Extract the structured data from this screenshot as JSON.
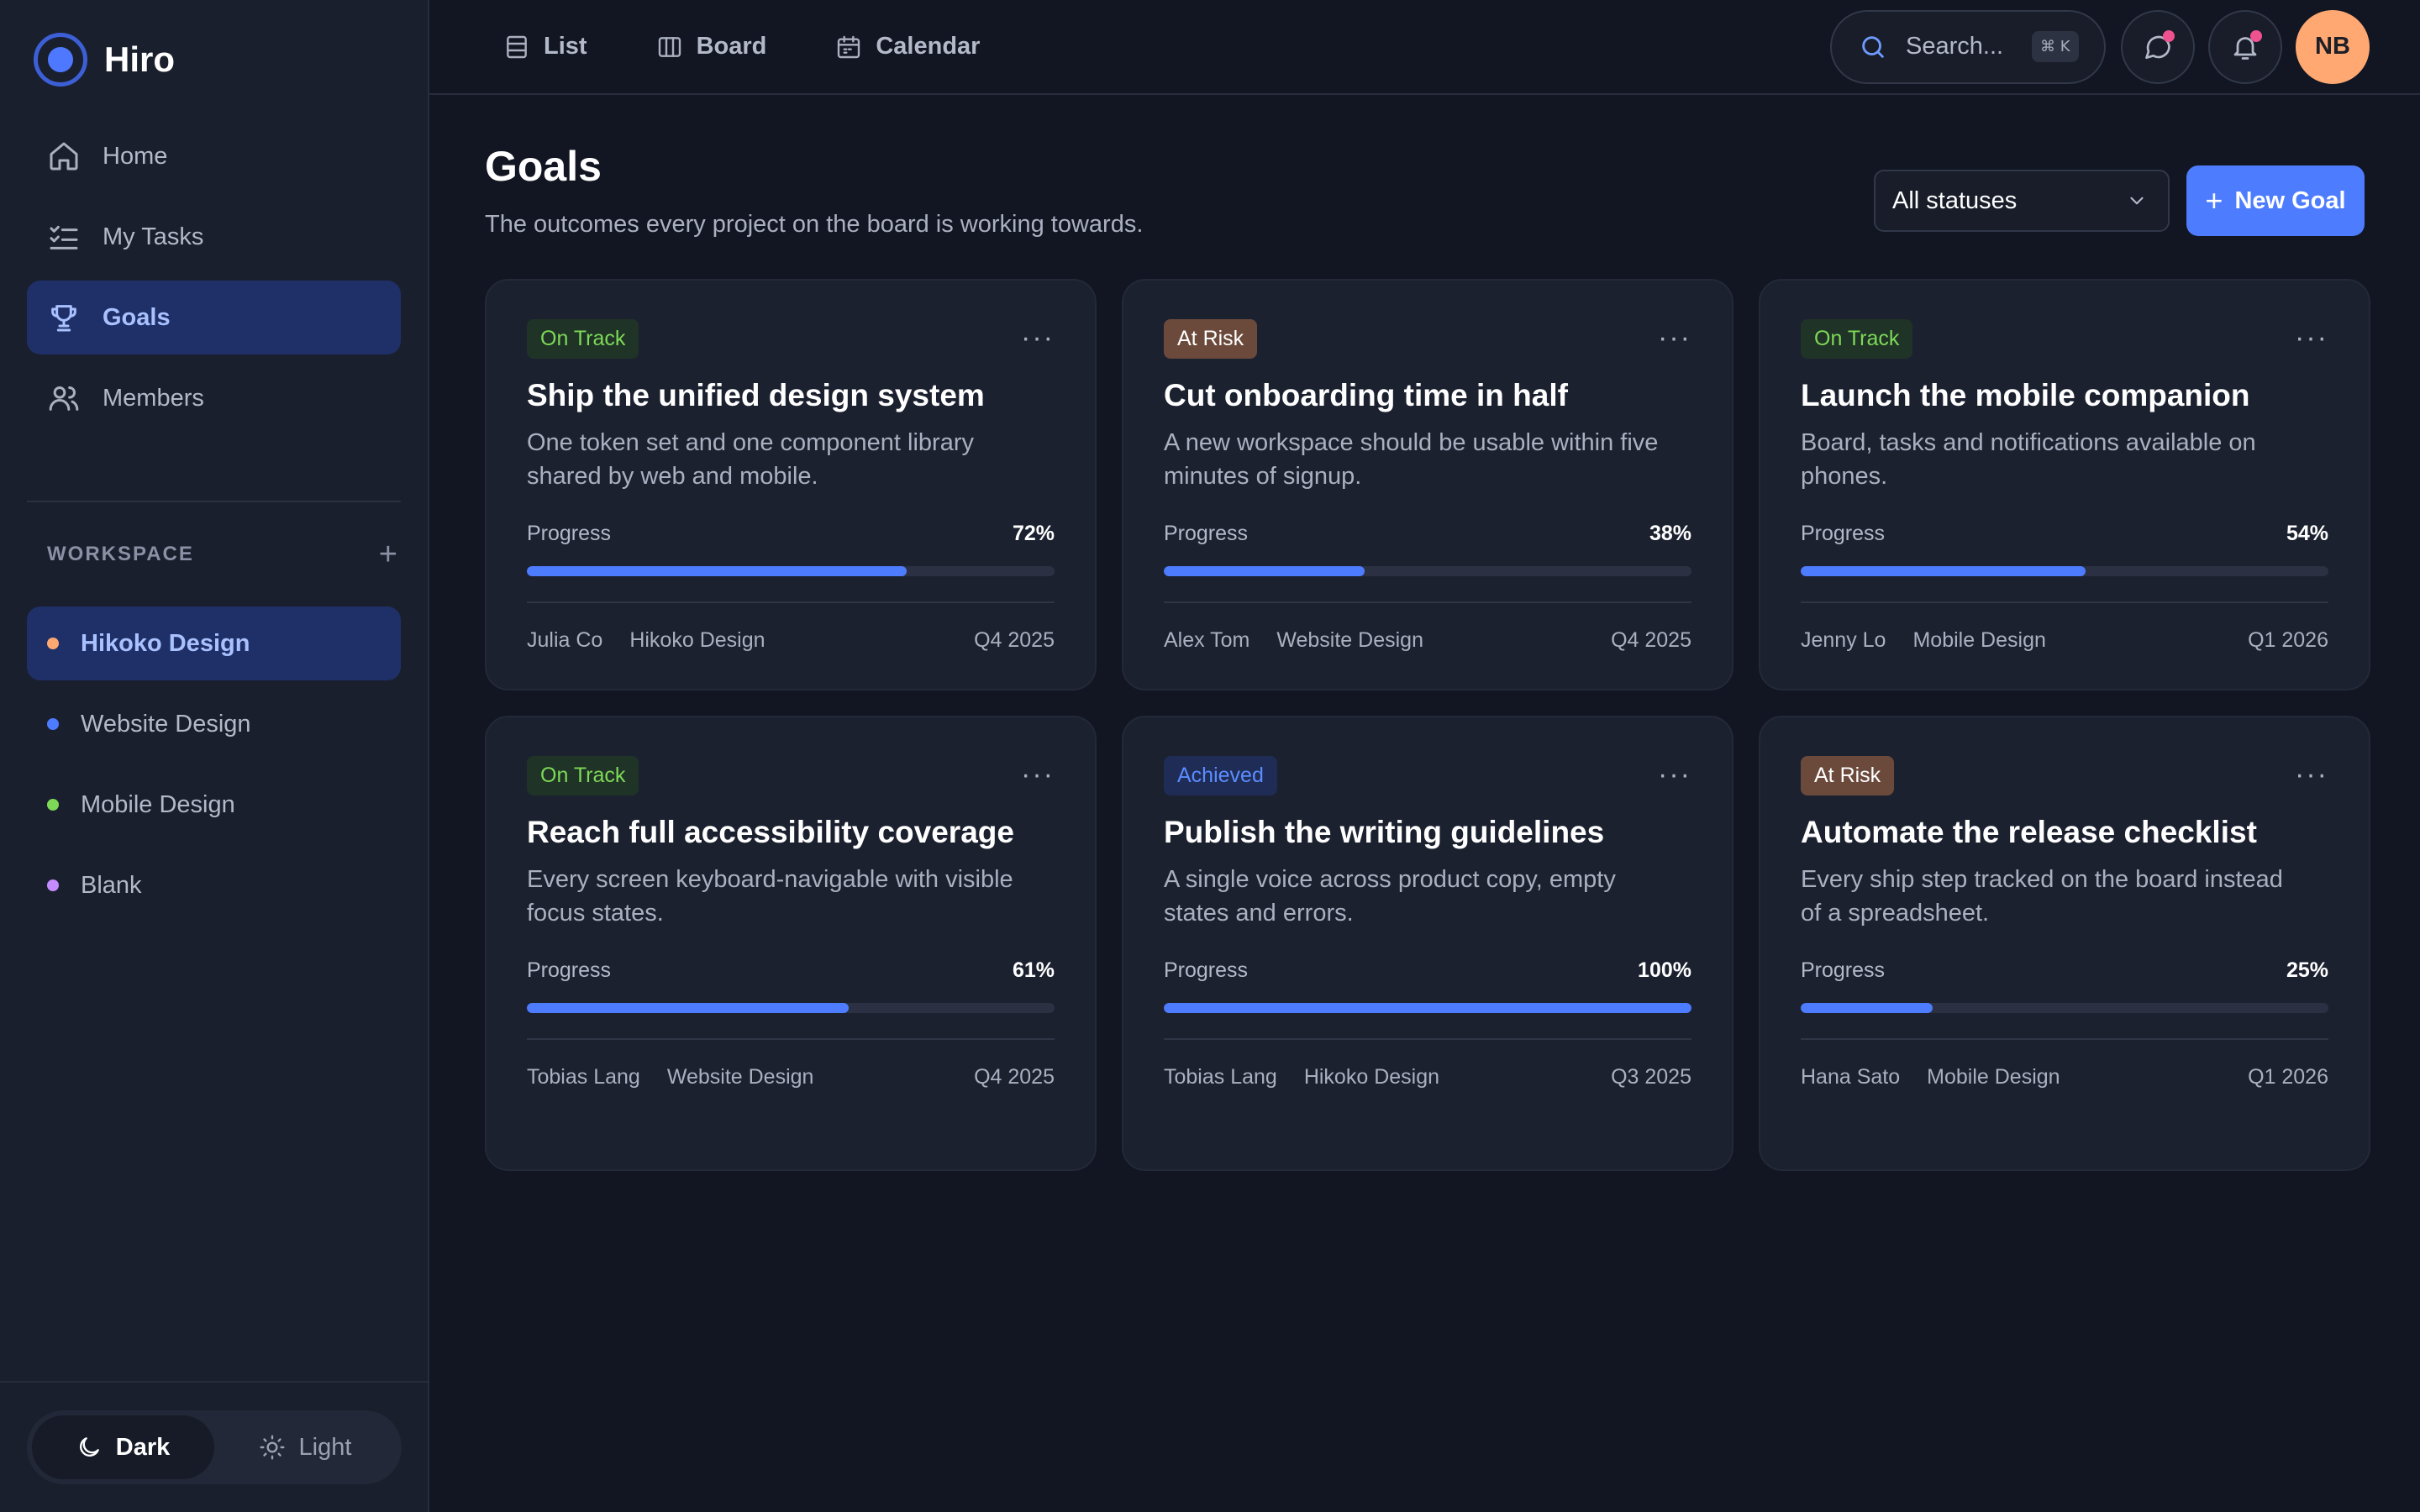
{
  "brand": {
    "name": "Hiro"
  },
  "nav": [
    {
      "label": "Home",
      "icon": "home-icon",
      "active": false
    },
    {
      "label": "My Tasks",
      "icon": "tasks-icon",
      "active": false
    },
    {
      "label": "Goals",
      "icon": "trophy-icon",
      "active": true
    },
    {
      "label": "Members",
      "icon": "members-icon",
      "active": false
    }
  ],
  "workspace": {
    "title": "WORKSPACE",
    "add_symbol": "+",
    "items": [
      {
        "label": "Hikoko Design",
        "color": "#ffa872",
        "active": true
      },
      {
        "label": "Website Design",
        "color": "#4d7cff",
        "active": false
      },
      {
        "label": "Mobile Design",
        "color": "#7ed957",
        "active": false
      },
      {
        "label": "Blank",
        "color": "#c58cff",
        "active": false
      }
    ]
  },
  "theme": {
    "dark_label": "Dark",
    "light_label": "Light",
    "selected": "dark"
  },
  "topbar": {
    "views": [
      {
        "label": "List",
        "icon": "list-icon"
      },
      {
        "label": "Board",
        "icon": "board-icon"
      },
      {
        "label": "Calendar",
        "icon": "calendar-icon"
      }
    ],
    "search_placeholder": "Search...",
    "search_shortcut": "⌘ K",
    "avatar_initials": "NB"
  },
  "page": {
    "title": "Goals",
    "subtitle": "The outcomes every project on the board is working towards.",
    "filter_value": "All statuses",
    "new_goal_label": "New Goal"
  },
  "status_styles": {
    "On Track": {
      "bg": "#1f3327",
      "fg": "#7ed957"
    },
    "At Risk": {
      "bg": "#6b4a3c",
      "fg": "#ffffff"
    },
    "Achieved": {
      "bg": "#1f2c55",
      "fg": "#5b8cff"
    }
  },
  "progress_label": "Progress",
  "goals": [
    {
      "status": "On Track",
      "title": "Ship the unified design system",
      "description": "One token set and one component library shared by web and mobile.",
      "progress": 72,
      "owner": "Julia Co",
      "project": "Hikoko Design",
      "quarter": "Q4 2025"
    },
    {
      "status": "At Risk",
      "title": "Cut onboarding time in half",
      "description": "A new workspace should be usable within five minutes of signup.",
      "progress": 38,
      "owner": "Alex Tom",
      "project": "Website Design",
      "quarter": "Q4 2025"
    },
    {
      "status": "On Track",
      "title": "Launch the mobile companion",
      "description": "Board, tasks and notifications available on phones.",
      "progress": 54,
      "owner": "Jenny Lo",
      "project": "Mobile Design",
      "quarter": "Q1 2026"
    },
    {
      "status": "On Track",
      "title": "Reach full accessibility coverage",
      "description": "Every screen keyboard-navigable with visible focus states.",
      "progress": 61,
      "owner": "Tobias Lang",
      "project": "Website Design",
      "quarter": "Q4 2025"
    },
    {
      "status": "Achieved",
      "title": "Publish the writing guidelines",
      "description": "A single voice across product copy, empty states and errors.",
      "progress": 100,
      "owner": "Tobias Lang",
      "project": "Hikoko Design",
      "quarter": "Q3 2025"
    },
    {
      "status": "At Risk",
      "title": "Automate the release checklist",
      "description": "Every ship step tracked on the board instead of a spreadsheet.",
      "progress": 25,
      "owner": "Hana Sato",
      "project": "Mobile Design",
      "quarter": "Q1 2026"
    }
  ]
}
